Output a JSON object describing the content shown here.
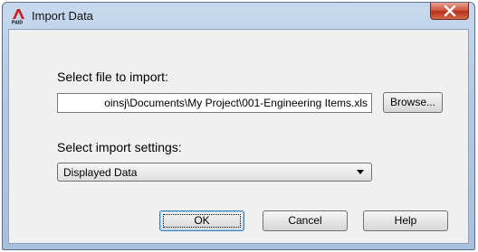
{
  "window": {
    "title": "Import Data",
    "icon_caption": "P&ID"
  },
  "file_section": {
    "label": "Select file to import:",
    "file_path_value": "oinsj\\Documents\\My Project\\001-Engineering Items.xls",
    "browse_label": "Browse..."
  },
  "settings_section": {
    "label": "Select import settings:",
    "selected_value": "Displayed Data"
  },
  "buttons": {
    "ok_label": "OK",
    "cancel_label": "Cancel",
    "help_label": "Help"
  },
  "colors": {
    "icon_red": "#c8201e",
    "close_red": "#c9462e"
  }
}
